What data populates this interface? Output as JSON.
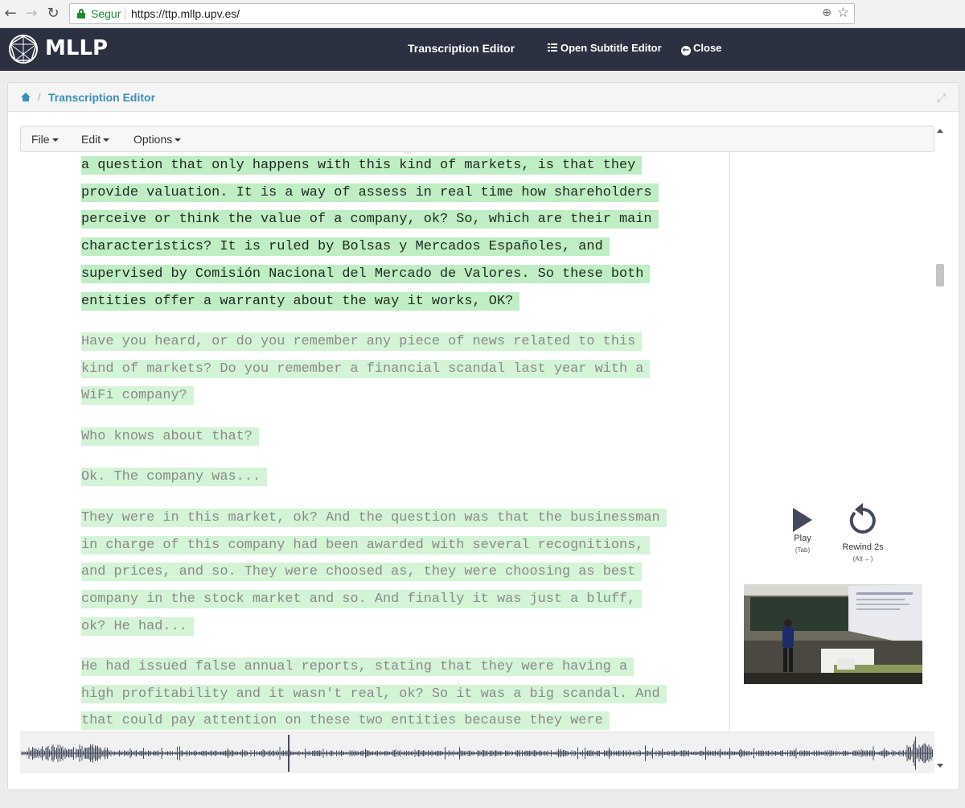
{
  "browser": {
    "secure_label": "Segur",
    "url": "https://ttp.mllp.upv.es/"
  },
  "header": {
    "brand": "MLLP",
    "title": "Transcription Editor",
    "subtitle_button": "Open Subtitle Editor",
    "close_button": "Close"
  },
  "breadcrumb": {
    "separator": "/",
    "current": "Transcription Editor"
  },
  "menu": {
    "file": "File",
    "edit": "Edit",
    "options": "Options"
  },
  "transcript": {
    "paragraphs": [
      {
        "state": "active",
        "lines": [
          "a question that only happens with this kind of markets, is that they",
          "provide valuation. It is a way of assess in real time how shareholders",
          "perceive or think the value of a company, ok? So, which are their main",
          "characteristics? It is ruled by Bolsas y Mercados Españoles, and",
          "supervised by Comisión Nacional del Mercado de Valores. So these both",
          "entities offer a warranty about the way it works, OK?"
        ]
      },
      {
        "state": "pending",
        "lines": [
          "Have you heard, or do you remember any piece of news related to this",
          "kind of markets? Do you remember a financial scandal last year with a",
          "WiFi company?"
        ]
      },
      {
        "state": "pending",
        "lines": [
          "Who knows about that?"
        ]
      },
      {
        "state": "pending",
        "lines": [
          "Ok. The company was..."
        ]
      },
      {
        "state": "pending",
        "lines": [
          "They were in this market, ok? And the question was that the businessman",
          "in charge of this company had been awarded with several recognitions,",
          "and prices, and so. They were choosed as, they were choosing as best",
          "company in the stock market and so. And finally it was just a bluff,",
          "ok? He had..."
        ]
      },
      {
        "state": "pending",
        "lines": [
          "He had issued false annual reports, stating that they were having a",
          "high profitability and it wasn't real, ok? So it was a big scandal. And",
          "that could pay attention on these two entities because they were"
        ]
      }
    ]
  },
  "player": {
    "play_label": "Play",
    "play_shortcut": "(Tab)",
    "rewind_label": "Rewind 2s",
    "rewind_shortcut": "(Alt ←)"
  },
  "colors": {
    "header_bg": "#2c3142",
    "link": "#3a8fb7",
    "highlight_active": "#bfeec4",
    "highlight_pending": "#d4f4d6"
  }
}
